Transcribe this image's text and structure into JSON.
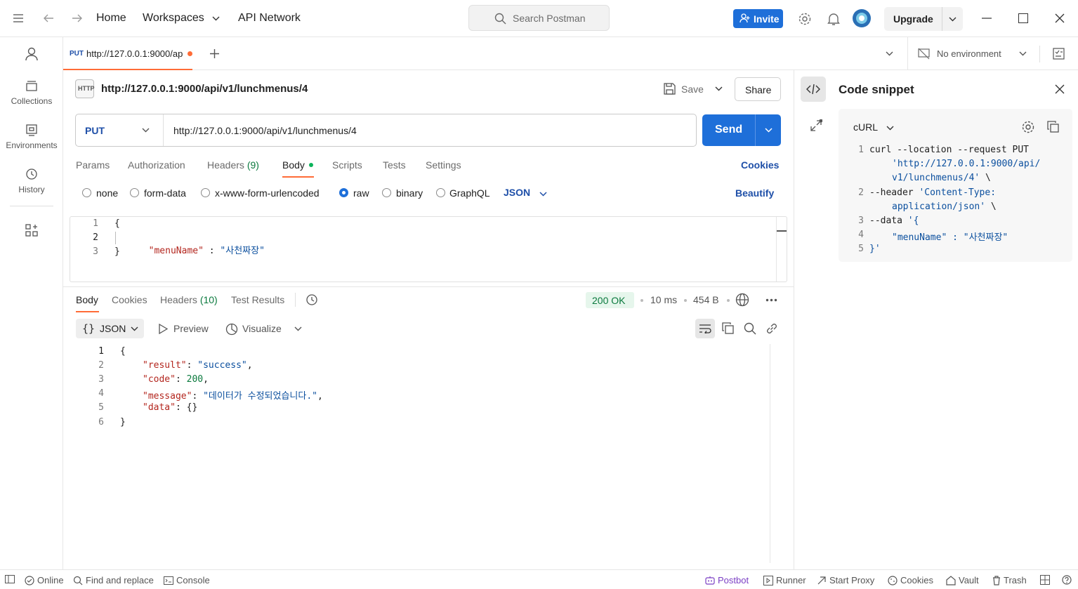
{
  "topbar": {
    "nav_home": "Home",
    "nav_workspaces": "Workspaces",
    "nav_api_network": "API Network",
    "search_placeholder": "Search Postman",
    "invite_label": "Invite",
    "upgrade_label": "Upgrade"
  },
  "sidebar": {
    "items": [
      {
        "label": "Collections",
        "icon": "collections-icon"
      },
      {
        "label": "Environments",
        "icon": "environments-icon"
      },
      {
        "label": "History",
        "icon": "history-icon"
      }
    ]
  },
  "tabs": {
    "active_method": "PUT",
    "active_title": "http://127.0.0.1:9000/ap",
    "environment": "No environment"
  },
  "request": {
    "icon_text": "HTTP",
    "title": "http://127.0.0.1:9000/api/v1/lunchmenus/4",
    "save_label": "Save",
    "share_label": "Share",
    "method": "PUT",
    "url": "http://127.0.0.1:9000/api/v1/lunchmenus/4",
    "send_label": "Send",
    "tabs": [
      {
        "label": "Params"
      },
      {
        "label": "Authorization"
      },
      {
        "label": "Headers",
        "count": "(9)"
      },
      {
        "label": "Body"
      },
      {
        "label": "Scripts"
      },
      {
        "label": "Tests"
      },
      {
        "label": "Settings"
      }
    ],
    "cookies_label": "Cookies",
    "body_types": [
      "none",
      "form-data",
      "x-www-form-urlencoded",
      "raw",
      "binary",
      "GraphQL"
    ],
    "selected_body_type": "raw",
    "format": "JSON",
    "beautify_label": "Beautify",
    "body_lines": [
      {
        "n": "1",
        "text": "{"
      },
      {
        "n": "2",
        "key": "\"menuName\"",
        "sep": " : ",
        "value": "\"사천짜장\""
      },
      {
        "n": "3",
        "text": "}"
      }
    ]
  },
  "response": {
    "tabs": [
      {
        "label": "Body"
      },
      {
        "label": "Cookies"
      },
      {
        "label": "Headers",
        "count": "(10)"
      },
      {
        "label": "Test Results"
      }
    ],
    "status": "200 OK",
    "time": "10 ms",
    "size": "454 B",
    "format": "JSON",
    "preview_label": "Preview",
    "visualize_label": "Visualize",
    "lines": [
      {
        "n": "1",
        "text": "{"
      },
      {
        "n": "2",
        "key": "\"result\"",
        "value": "\"success\"",
        "type": "str",
        "trail": ","
      },
      {
        "n": "3",
        "key": "\"code\"",
        "value": "200",
        "type": "num",
        "trail": ","
      },
      {
        "n": "4",
        "key": "\"message\"",
        "value": "\"데이터가 수정되었습니다.\"",
        "type": "str",
        "trail": ","
      },
      {
        "n": "5",
        "key": "\"data\"",
        "value": "{}",
        "type": "punct",
        "trail": ""
      },
      {
        "n": "6",
        "text": "}"
      }
    ]
  },
  "snippet": {
    "title": "Code snippet",
    "language": "cURL",
    "lines": [
      {
        "n": "1",
        "a": "curl --location --request PUT",
        "b": "'http://127.0.0.1:9000/api/",
        "c": "v1/lunchmenus/4'",
        "d": " \\"
      },
      {
        "n": "2",
        "a": "--header ",
        "b": "'Content-Type:",
        "c": "application/json'",
        "d": " \\"
      },
      {
        "n": "3",
        "a": "--data ",
        "b": "'{"
      },
      {
        "n": "4",
        "key": "\"menuName\"",
        "sep": " : ",
        "value": "\"사천짜장\""
      },
      {
        "n": "5",
        "text": "}'"
      }
    ]
  },
  "statusbar": {
    "online": "Online",
    "find_replace": "Find and replace",
    "console": "Console",
    "postbot": "Postbot",
    "runner": "Runner",
    "start_proxy": "Start Proxy",
    "cookies": "Cookies",
    "vault": "Vault",
    "trash": "Trash"
  },
  "colors": {
    "accent": "#1e6fd9",
    "orange": "#ff6c37",
    "success": "#0b7a3e"
  }
}
